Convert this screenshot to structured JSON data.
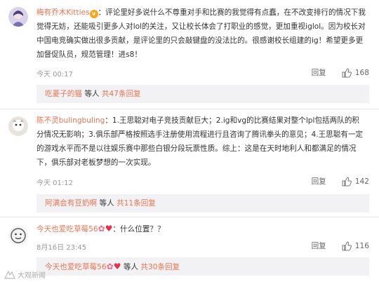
{
  "comments": [
    {
      "username": "梅有乔木Kitties",
      "text": "：评论里好多说什么不尊重对手和比赛的我觉得有点蠢，在不改变排行的情况下我觉得无妨，还能吸引更多人对lol的关注，又让校长体会了打职业的感觉，更加重视iglol。因为校长对中国电竞确实做出很多贡献，是评论里的只会敲键盘的没法比的。很感谢校长组建的ig！希望更多更加督促队员，规范管理！进s8！",
      "time": "今天 00:17",
      "reply_label": "回复",
      "likes": "168",
      "sub_link": "吃菱子的猫",
      "sub_text": " 等人 ",
      "sub_count": "共47条回复"
    },
    {
      "username": "陈不灵bulingbuling",
      "text": "：1.王思聪对电子竞技贡献巨大；2.ig和vg的比赛结果对整个lpl包括两队的积分情况无影响；3.俱乐部严格按照选手注册使用流程进行且咨询了腾讯拳头的意见；4.王思聪有一定的游戏水平而不是以往娱乐赛中那些白银分段玩票性质。综上：这是在天时地利人和都满足的情况下，俱乐部对老板梦想的一次实现。",
      "time": "今天 01:12",
      "reply_label": "回复",
      "likes": "142",
      "sub_link": "阿满会有豆奶啊",
      "sub_text": " 等人 ",
      "sub_count": "共11条回复"
    },
    {
      "username": "今天也爱吃草莓56",
      "text": "：什么位置？？",
      "time": "8月16日 23:45",
      "reply_label": "回复",
      "likes": "116",
      "sub_link": "今天也爱吃草莓56",
      "sub_text": " 等人 ",
      "sub_count": "共30条回复"
    }
  ],
  "watermark": "大观新闻",
  "colors": {
    "accent": "#eb7350",
    "sub_bg": "#f2f2f5",
    "meta": "#999999"
  }
}
